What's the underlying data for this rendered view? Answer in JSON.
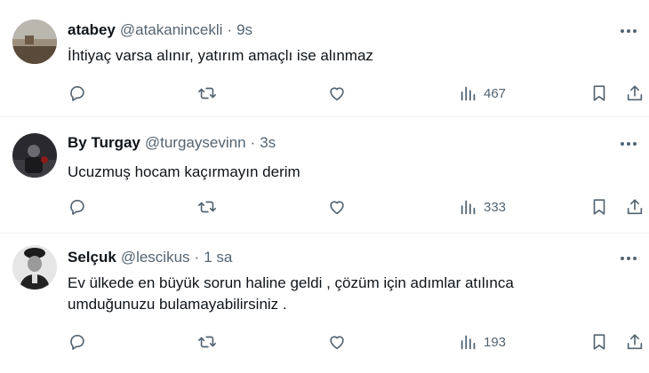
{
  "colors": {
    "text": "#0f1419",
    "secondary": "#536471",
    "divider": "#eff3f4"
  },
  "tweets": [
    {
      "name": "atabey",
      "handle": "@atakanincekli",
      "dot": "·",
      "time": "9s",
      "text": "İhtiyaç varsa alınır, yatırım amaçlı ise alınmaz",
      "views": "467",
      "avatar": "avatar-landscape-photo"
    },
    {
      "name": "By Turgay",
      "handle": "@turgaysevinn",
      "dot": "·",
      "time": "3s",
      "text": "Ucuzmuş hocam kaçırmayın derim",
      "views": "333",
      "avatar": "avatar-dark-photo"
    },
    {
      "name": "Selçuk",
      "handle": "@lescikus",
      "dot": "·",
      "time": "1 sa",
      "text": "Ev ülkede en büyük sorun haline geldi , çözüm için adımlar atılınca umduğunuzu bulamayabilirsiniz .",
      "views": "193",
      "avatar": "avatar-portrait-photo"
    }
  ]
}
